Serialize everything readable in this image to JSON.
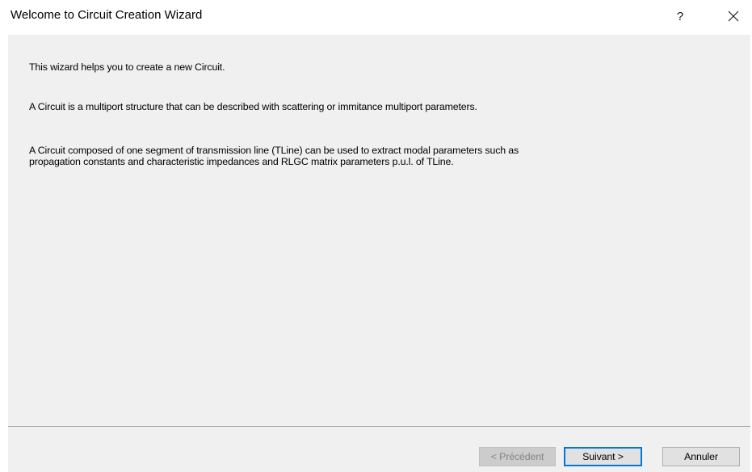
{
  "window": {
    "title": "Welcome to Circuit Creation Wizard",
    "help_label": "?",
    "close_icon": "close-icon"
  },
  "content": {
    "paragraphs": [
      "This wizard helps you to create a new Circuit.",
      "A Circuit is a multiport structure that can be described with scattering or immitance multiport parameters.",
      "A Circuit composed of one segment of transmission line (TLine) can be used to extract modal parameters such as propagation constants and characteristic impedances and RLGC matrix parameters p.u.l. of TLine."
    ]
  },
  "buttons": {
    "previous": "< Précédent",
    "next": "Suivant >",
    "cancel": "Annuler"
  },
  "colors": {
    "content_background": "#f0f0f0",
    "default_button_border": "#0078d7",
    "disabled_text": "#838383"
  }
}
